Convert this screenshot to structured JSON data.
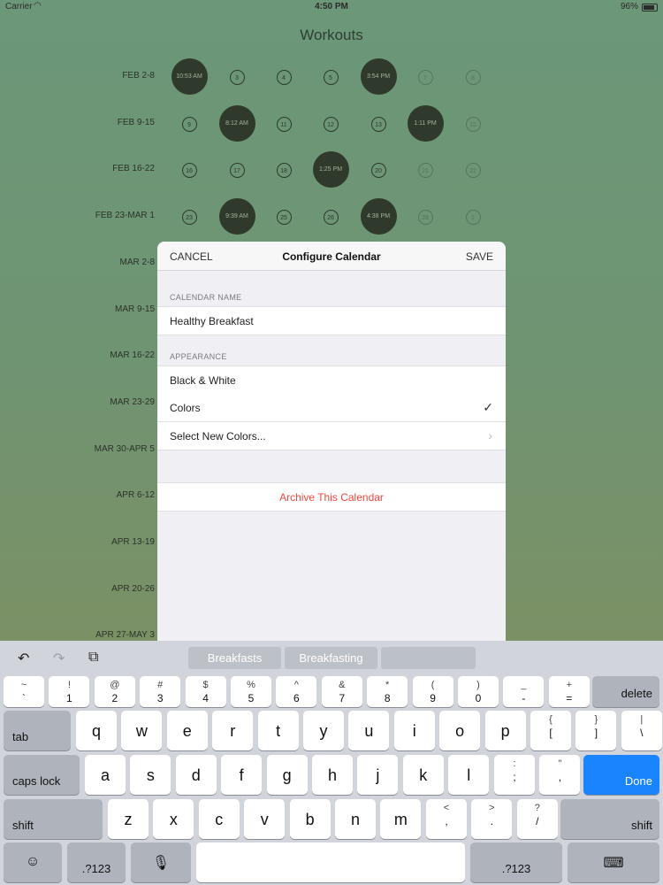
{
  "status": {
    "carrier": "Carrier",
    "time": "4:50 PM",
    "battery": "96%"
  },
  "app": {
    "title": "Workouts"
  },
  "weeks": [
    {
      "label": "FEB 2-8",
      "days": [
        {
          "t": "10:53 AM",
          "done": true
        },
        {
          "t": "3"
        },
        {
          "t": "4"
        },
        {
          "t": "5"
        },
        {
          "t": "3:54 PM",
          "done": true
        },
        {
          "t": "7",
          "faded": true
        },
        {
          "t": "8",
          "faded": true
        }
      ]
    },
    {
      "label": "FEB 9-15",
      "days": [
        {
          "t": "9"
        },
        {
          "t": "8:12 AM",
          "done": true
        },
        {
          "t": "11"
        },
        {
          "t": "12"
        },
        {
          "t": "13"
        },
        {
          "t": "1:11 PM",
          "done": true
        },
        {
          "t": "15",
          "faded": true
        }
      ]
    },
    {
      "label": "FEB 16-22",
      "days": [
        {
          "t": "16"
        },
        {
          "t": "17"
        },
        {
          "t": "18"
        },
        {
          "t": "1:25 PM",
          "done": true
        },
        {
          "t": "20"
        },
        {
          "t": "21",
          "faded": true
        },
        {
          "t": "22",
          "faded": true
        }
      ]
    },
    {
      "label": "FEB 23-MAR 1",
      "days": [
        {
          "t": "23"
        },
        {
          "t": "9:39 AM",
          "done": true
        },
        {
          "t": "25"
        },
        {
          "t": "26"
        },
        {
          "t": "4:38 PM",
          "done": true
        },
        {
          "t": "28",
          "faded": true
        },
        {
          "t": "1",
          "faded": true
        }
      ]
    },
    {
      "label": "MAR 2-8",
      "days": []
    },
    {
      "label": "MAR 9-15",
      "days": []
    },
    {
      "label": "MAR 16-22",
      "days": []
    },
    {
      "label": "MAR 23-29",
      "days": []
    },
    {
      "label": "MAR 30-APR 5",
      "days": []
    },
    {
      "label": "APR 6-12",
      "days": []
    },
    {
      "label": "APR 13-19",
      "days": []
    },
    {
      "label": "APR 20-26",
      "days": []
    },
    {
      "label": "APR 27-MAY 3",
      "days": []
    }
  ],
  "modal": {
    "cancel": "CANCEL",
    "title": "Configure Calendar",
    "save": "SAVE",
    "name_section": "CALENDAR NAME",
    "name_value": "Healthy Breakfast",
    "appearance_section": "APPEARANCE",
    "option_bw": "Black & White",
    "option_colors": "Colors",
    "option_select": "Select New Colors...",
    "archive": "Archive This Calendar"
  },
  "keyboard": {
    "suggestions": [
      "Breakfasts",
      "Breakfasting",
      ""
    ],
    "row1": [
      {
        "top": "~",
        "bot": "`"
      },
      {
        "top": "!",
        "bot": "1"
      },
      {
        "top": "@",
        "bot": "2"
      },
      {
        "top": "#",
        "bot": "3"
      },
      {
        "top": "$",
        "bot": "4"
      },
      {
        "top": "%",
        "bot": "5"
      },
      {
        "top": "^",
        "bot": "6"
      },
      {
        "top": "&",
        "bot": "7"
      },
      {
        "top": "*",
        "bot": "8"
      },
      {
        "top": "(",
        "bot": "9"
      },
      {
        "top": ")",
        "bot": "0"
      },
      {
        "top": "_",
        "bot": "-"
      },
      {
        "top": "+",
        "bot": "="
      }
    ],
    "delete": "delete",
    "tab": "tab",
    "row2": [
      "q",
      "w",
      "e",
      "r",
      "t",
      "y",
      "u",
      "i",
      "o",
      "p"
    ],
    "row2_sym": [
      {
        "top": "{",
        "bot": "["
      },
      {
        "top": "}",
        "bot": "]"
      },
      {
        "top": "|",
        "bot": "\\"
      }
    ],
    "caps": "caps lock",
    "row3": [
      "a",
      "s",
      "d",
      "f",
      "g",
      "h",
      "j",
      "k",
      "l"
    ],
    "row3_sym": [
      {
        "top": ":",
        "bot": ";"
      },
      {
        "top": "\"",
        "bot": ","
      }
    ],
    "done": "Done",
    "shift": "shift",
    "row4": [
      "z",
      "x",
      "c",
      "v",
      "b",
      "n",
      "m"
    ],
    "row4_sym": [
      {
        "top": "<",
        "bot": ","
      },
      {
        "top": ">",
        "bot": "."
      },
      {
        "top": "?",
        "bot": "/"
      }
    ],
    "num": ".?123"
  }
}
